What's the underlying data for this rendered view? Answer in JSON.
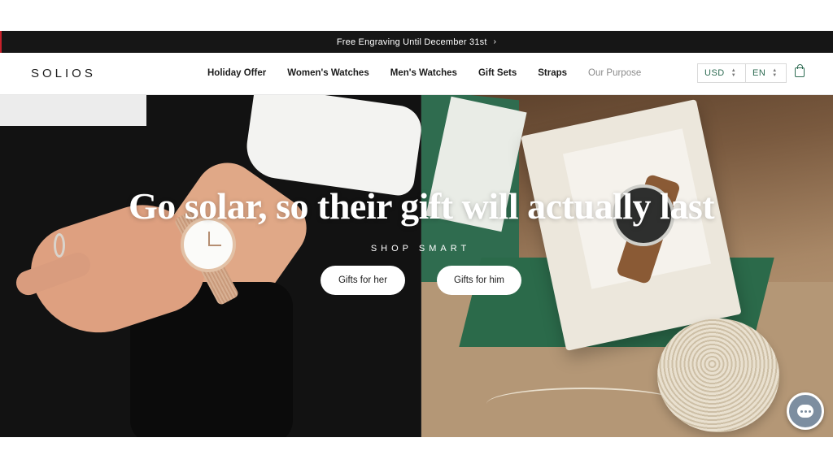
{
  "announcement": {
    "text": "Free Engraving Until December 31st",
    "icon": "chevron-right-icon"
  },
  "header": {
    "logo": "SOLIOS",
    "nav": [
      "Holiday Offer",
      "Women's Watches",
      "Men's Watches",
      "Gift Sets",
      "Straps",
      "Our Purpose"
    ],
    "currency": "USD",
    "language": "EN",
    "cart_icon": "shopping-bag-icon",
    "accent_color": "#2d6b52"
  },
  "hero": {
    "headline": "Go solar, so their gift will actually last",
    "kicker": "SHOP SMART",
    "buttons": [
      "Gifts for her",
      "Gifts for him"
    ]
  },
  "chat": {
    "icon": "chat-bubble-icon"
  }
}
